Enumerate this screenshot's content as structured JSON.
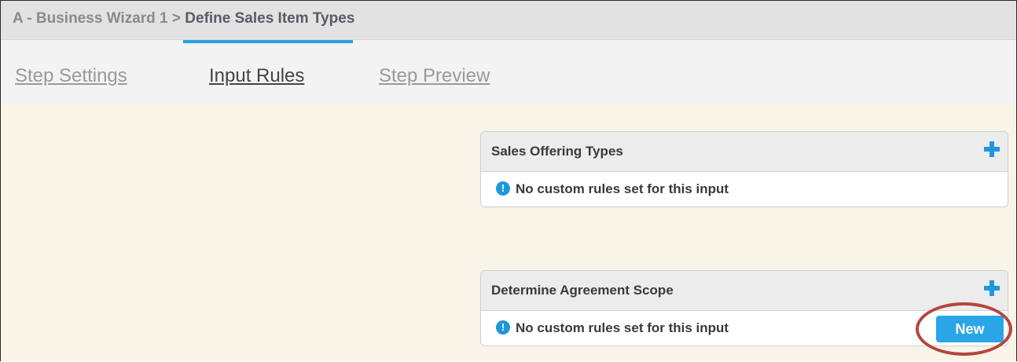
{
  "header": {
    "breadcrumb_parent": "A - Business Wizard 1 >",
    "breadcrumb_current": "Define Sales Item Types"
  },
  "tabs": [
    {
      "label": "Step Settings",
      "active": false
    },
    {
      "label": "Input Rules",
      "active": true
    },
    {
      "label": "Step Preview",
      "active": false
    }
  ],
  "panels": [
    {
      "title": "Sales Offering Types",
      "message": "No custom rules set for this input"
    },
    {
      "title": "Determine Agreement Scope",
      "message": "No custom rules set for this input",
      "button_label": "New"
    }
  ],
  "colors": {
    "accent": "#29a2e0",
    "button": "#2aa6e8",
    "highlight": "#b5453c",
    "background": "#f9f4e8"
  }
}
